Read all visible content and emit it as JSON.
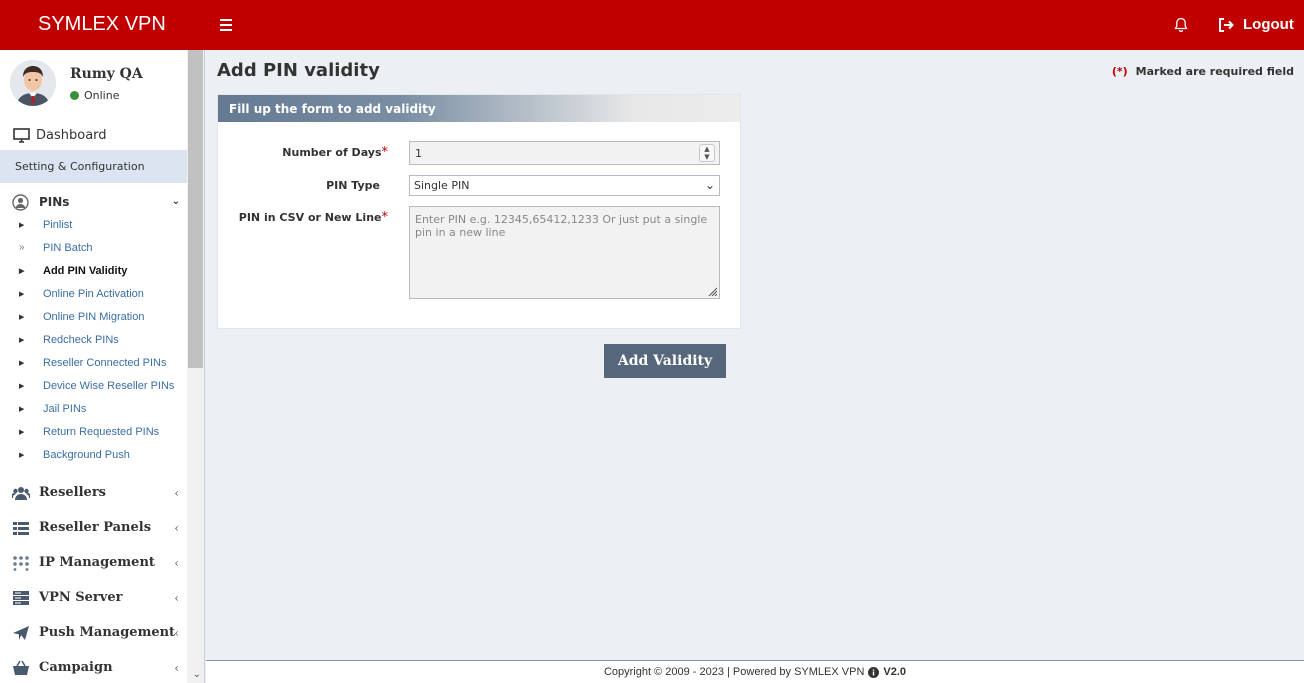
{
  "header": {
    "brand": "SYMLEX VPN",
    "logout_label": "Logout"
  },
  "user": {
    "name": "Rumy QA",
    "status": "Online"
  },
  "sidebar": {
    "dashboard": "Dashboard",
    "setting": "Setting & Configuration",
    "pins_label": "PINs",
    "pins_items": [
      "Pinlist",
      "PIN Batch",
      "Add PIN Validity",
      "Online Pin Activation",
      "Online PIN Migration",
      "Redcheck PINs",
      "Reseller Connected PINs",
      "Device Wise Reseller PINs",
      "Jail PINs",
      "Return Requested PINs",
      "Background Push"
    ],
    "menu": [
      "Resellers",
      "Reseller Panels",
      "IP Management",
      "VPN Server",
      "Push Management",
      "Campaign"
    ]
  },
  "page": {
    "title": "Add PIN validity",
    "required_mark": "(*)",
    "required_note": "Marked are required field"
  },
  "form": {
    "header": "Fill up the form to add validity",
    "days_label": "Number of Days",
    "days_value": "1",
    "pin_type_label": "PIN Type",
    "pin_type_value": "Single PIN",
    "pins_label": "PIN in CSV or New Line",
    "pins_placeholder": "Enter PIN e.g. 12345,65412,1233 Or just put a single pin in a new line",
    "required_star": "*",
    "submit_label": "Add Validity"
  },
  "footer": {
    "copyright": "Copyright © 2009 - 2023 | Powered by SYMLEX VPN",
    "version": "V2.0"
  },
  "colors": {
    "brand": "#c00000",
    "button": "#56677c",
    "active_section": "#dce4f2"
  }
}
